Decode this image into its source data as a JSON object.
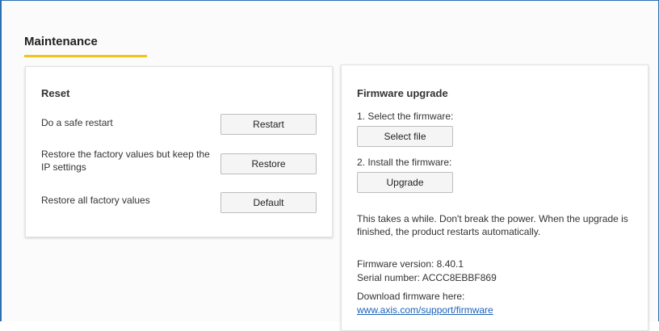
{
  "page_title": "Maintenance",
  "reset": {
    "title": "Reset",
    "rows": [
      {
        "label": "Do a safe restart",
        "button": "Restart"
      },
      {
        "label": "Restore the factory values but keep the IP settings",
        "button": "Restore"
      },
      {
        "label": "Restore all factory values",
        "button": "Default"
      }
    ]
  },
  "firmware": {
    "title": "Firmware upgrade",
    "step1_label": "1. Select the firmware:",
    "select_button": "Select file",
    "step2_label": "2. Install the firmware:",
    "upgrade_button": "Upgrade",
    "note": "This takes a while. Don't break the power. When the upgrade is finished, the product restarts automatically.",
    "version_text": "Firmware version: 8.40.1",
    "serial_text": "Serial number: ACCC8EBBF869",
    "download_label": "Download firmware here:",
    "download_link": "www.axis.com/support/firmware"
  },
  "colors": {
    "accent_underline": "#f2c318",
    "frame_border": "#2f6fb3",
    "link": "#1a62b8"
  }
}
